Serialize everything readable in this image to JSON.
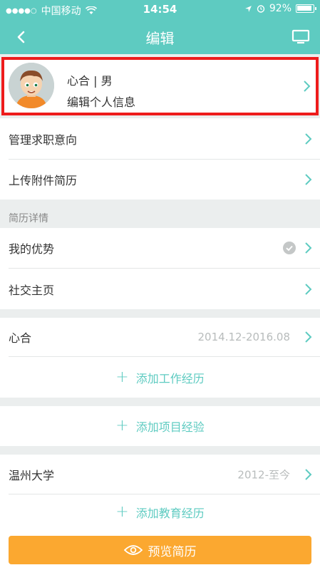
{
  "status": {
    "carrier": "中国移动",
    "time": "14:54",
    "battery": "92%"
  },
  "nav": {
    "title": "编辑"
  },
  "profile": {
    "name": "心合 | 男",
    "edit_label": "编辑个人信息"
  },
  "job": {
    "manage_intent": "管理求职意向",
    "upload_resume": "上传附件简历"
  },
  "details": {
    "header": "简历详情",
    "advantage": "我的优势",
    "social": "社交主页"
  },
  "work": {
    "company": "心合",
    "period": "2014.12-2016.08",
    "add_label": "添加工作经历"
  },
  "project": {
    "add_label": "添加项目经验"
  },
  "education": {
    "school": "温州大学",
    "period": "2012-至今",
    "add_label": "添加教育经历"
  },
  "bottom": {
    "preview_label": "预览简历"
  },
  "colors": {
    "accent": "#5ecbc1",
    "button": "#fba830",
    "highlight": "#ee1c1c"
  }
}
